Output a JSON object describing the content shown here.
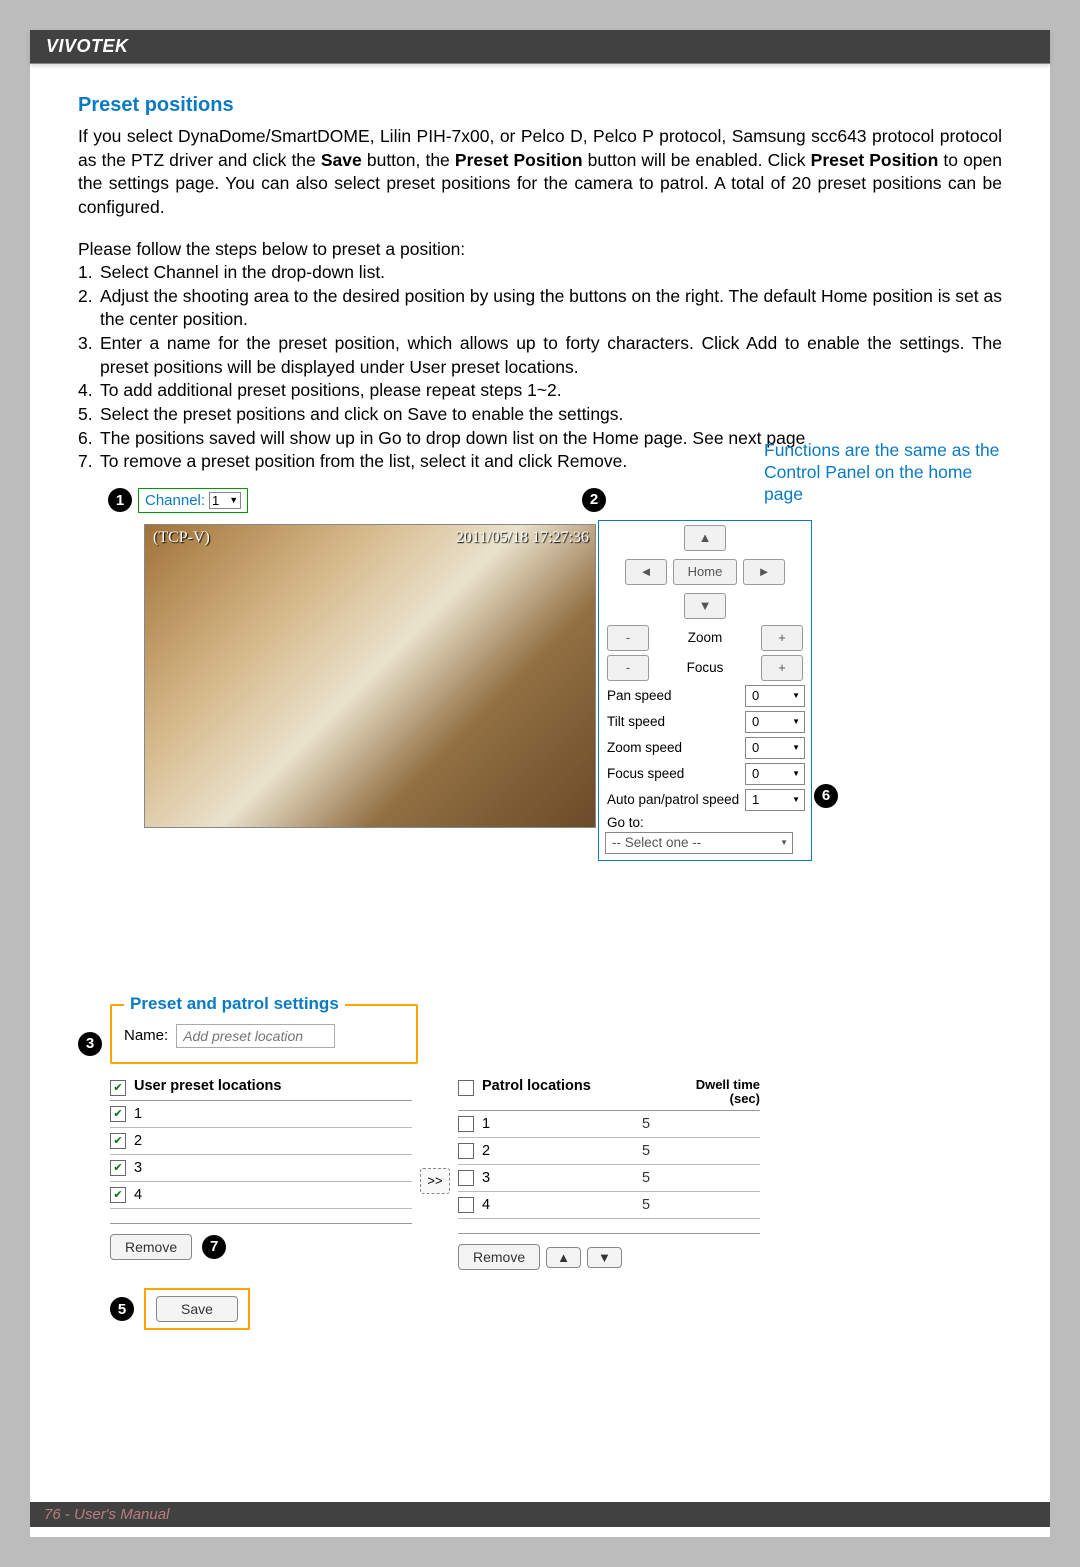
{
  "header": {
    "brand": "VIVOTEK"
  },
  "section": {
    "title": "Preset positions",
    "intro": "If you select DynaDome/SmartDOME, Lilin PIH-7x00, or Pelco D, Pelco P protocol, Samsung scc643 protocol protocol as the PTZ driver and click the Save button, the Preset Position button will be enabled. Click Preset Position to open the settings page. You can also select preset positions for the camera to patrol. A total of 20 preset positions can be configured.",
    "steps_intro": "Please follow the steps below to preset a position:",
    "steps": [
      "Select Channel in the drop-down list.",
      "Adjust the shooting area to the desired position by using the buttons on the right. The default Home position is set as the center position.",
      "Enter a name for the preset position, which allows up to forty characters. Click Add to enable the settings. The preset positions will be displayed under User preset locations.",
      "To add additional preset positions, please repeat steps 1~2.",
      "Select the preset positions and click on Save to enable the settings.",
      "The positions saved will show up in Go to drop down list on the Home page. See next page",
      "To remove a preset position from the list, select it and click Remove."
    ],
    "note_blue": "Functions are the same as the Control Panel on the home page"
  },
  "callouts": {
    "c1": "1",
    "c2": "2",
    "c3": "3",
    "c5": "5",
    "c6": "6",
    "c7": "7"
  },
  "channel": {
    "label": "Channel:",
    "value": "1"
  },
  "video": {
    "label": "(TCP-V)",
    "timestamp": "2011/05/18 17:27:36"
  },
  "control_panel": {
    "home": "Home",
    "zoom_label": "Zoom",
    "focus_label": "Focus",
    "minus": "-",
    "plus": "+",
    "up": "▲",
    "down": "▼",
    "left": "◄",
    "right": "►",
    "speeds": [
      {
        "label": "Pan speed",
        "value": "0"
      },
      {
        "label": "Tilt speed",
        "value": "0"
      },
      {
        "label": "Zoom speed",
        "value": "0"
      },
      {
        "label": "Focus speed",
        "value": "0"
      },
      {
        "label": "Auto pan/patrol speed",
        "value": "1"
      }
    ],
    "goto_label": "Go to:",
    "goto_value": "-- Select one --"
  },
  "preset_patrol": {
    "legend": "Preset and patrol settings",
    "name_label": "Name:",
    "name_placeholder": "Add preset location",
    "user_header": "User preset locations",
    "patrol_header": "Patrol locations",
    "dwell_header_1": "Dwell time",
    "dwell_header_2": "(sec)",
    "user_rows": [
      "1",
      "2",
      "3",
      "4"
    ],
    "patrol_rows": [
      {
        "loc": "1",
        "dwell": "5"
      },
      {
        "loc": "2",
        "dwell": "5"
      },
      {
        "loc": "3",
        "dwell": "5"
      },
      {
        "loc": "4",
        "dwell": "5"
      }
    ],
    "move_btn": ">>",
    "remove_label": "Remove",
    "up_icon": "▲",
    "down_icon": "▼",
    "save_label": "Save"
  },
  "footer": {
    "page": "76 - User's Manual"
  }
}
